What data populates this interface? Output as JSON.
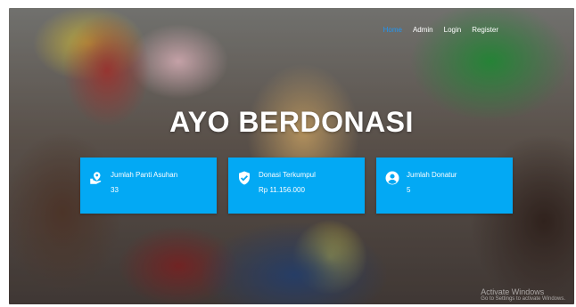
{
  "nav": {
    "items": [
      {
        "label": "Home",
        "active": true
      },
      {
        "label": "Admin",
        "active": false
      },
      {
        "label": "Login",
        "active": false
      },
      {
        "label": "Register",
        "active": false
      }
    ]
  },
  "hero": {
    "title": "AYO BERDONASI"
  },
  "stats": [
    {
      "icon": "building-icon",
      "title": "Jumlah Panti Asuhan",
      "value": "33"
    },
    {
      "icon": "shield-check-icon",
      "title": "Donasi Terkumpul",
      "value": "Rp 11.156.000"
    },
    {
      "icon": "user-circle-icon",
      "title": "Jumlah Donatur",
      "value": "5"
    }
  ],
  "watermark": {
    "title": "Activate Windows",
    "subtitle": "Go to Settings to activate Windows."
  },
  "colors": {
    "card": "#03a9f4",
    "nav_active": "#2196f3"
  }
}
